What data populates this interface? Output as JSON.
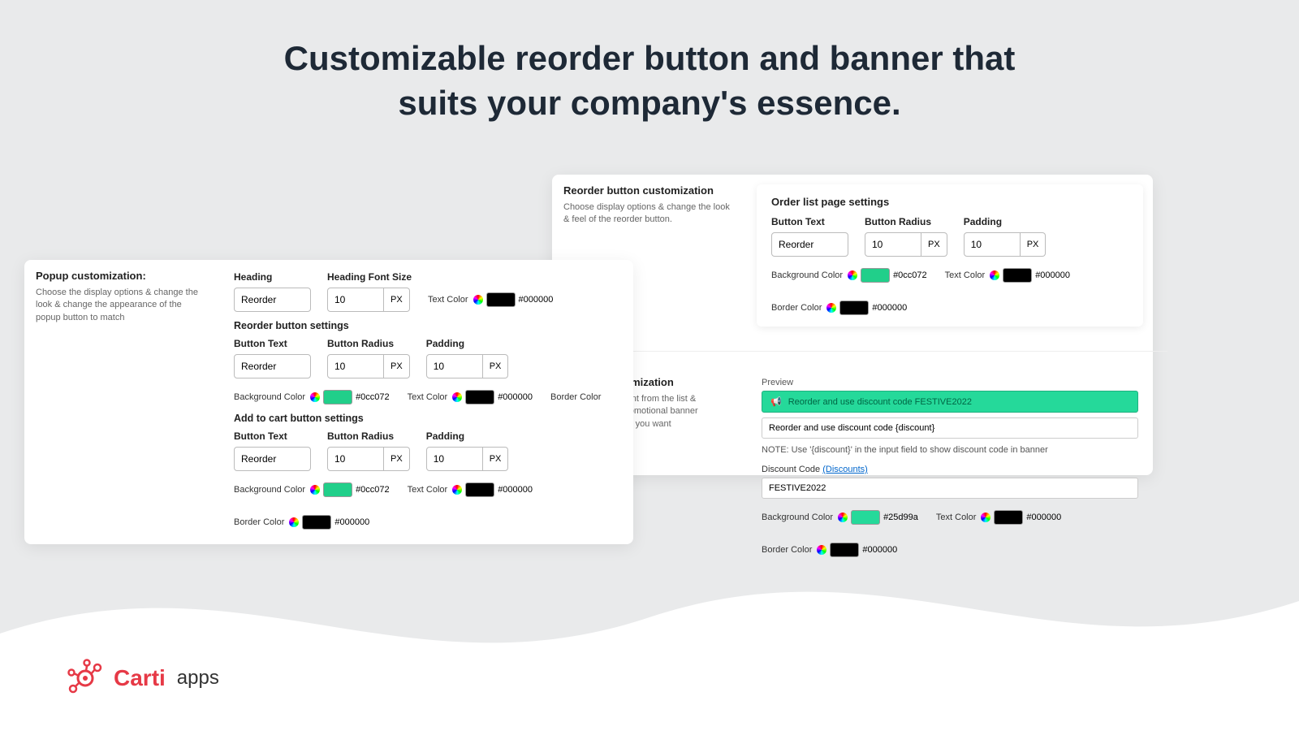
{
  "hero": {
    "line1": "Customizable reorder button and banner that",
    "line2": "suits your company's essence."
  },
  "popup": {
    "title": "Popup customization:",
    "desc": "Choose the display options & change the look & change the appearance of the popup button to match",
    "heading": {
      "label": "Heading",
      "value": "Reorder"
    },
    "headingFont": {
      "label": "Heading Font Size",
      "value": "10",
      "unit": "PX"
    },
    "textColor": {
      "label": "Text Color",
      "hex": "#000000",
      "swatch": "#000000"
    },
    "reorderSection": "Reorder button settings",
    "cartSection": "Add to cart button settings",
    "btnText": {
      "label": "Button Text",
      "value": "Reorder"
    },
    "btnRadius": {
      "label": "Button Radius",
      "value": "10",
      "unit": "PX"
    },
    "padding": {
      "label": "Padding",
      "value": "10",
      "unit": "PX"
    },
    "bg": {
      "label": "Background Color",
      "hex": "#0cc072",
      "swatch": "#21cf8a"
    },
    "tc": {
      "label": "Text Color",
      "hex": "#000000",
      "swatch": "#000000"
    },
    "bc": {
      "label": "Border Color",
      "hex": "#000000",
      "swatch": "#000000"
    }
  },
  "orderPanel": {
    "leftTitle": "Reorder button customization",
    "leftDesc": "Choose display options & change the look & feel of the reorder button.",
    "rightTitle": "Order list page settings",
    "btnText": {
      "label": "Button Text",
      "value": "Reorder"
    },
    "btnRadius": {
      "label": "Button Radius",
      "value": "10",
      "unit": "PX"
    },
    "padding": {
      "label": "Padding",
      "value": "10",
      "unit": "PX"
    },
    "bg": {
      "label": "Background Color",
      "hex": "#0cc072",
      "swatch": "#21cf8a"
    },
    "tc": {
      "label": "Text Color",
      "hex": "#000000",
      "swatch": "#000000"
    },
    "bc": {
      "label": "Border Color",
      "hex": "#000000",
      "swatch": "#000000"
    }
  },
  "bannerPanel": {
    "leftTitle": "Banner customization",
    "leftDesc": "Select the discount from the list & customize the promotional banner message the way you want",
    "previewLabel": "Preview",
    "bannerText": "Reorder and use discount code FESTIVE2022",
    "inputPlaceholder": "Reorder and use discount code {discount}",
    "note": "NOTE: Use '{discount}' in the input field to show discount code in banner",
    "discLabel": "Discount Code",
    "discLink": "(Discounts)",
    "discValue": "FESTIVE2022",
    "bg": {
      "label": "Background Color",
      "hex": "#25d99a",
      "swatch": "#25d99a"
    },
    "tc": {
      "label": "Text Color",
      "hex": "#000000",
      "swatch": "#000000"
    },
    "bc": {
      "label": "Border Color",
      "hex": "#000000",
      "swatch": "#000000"
    }
  },
  "brand": {
    "name": "Carti",
    "suffix": "apps"
  }
}
